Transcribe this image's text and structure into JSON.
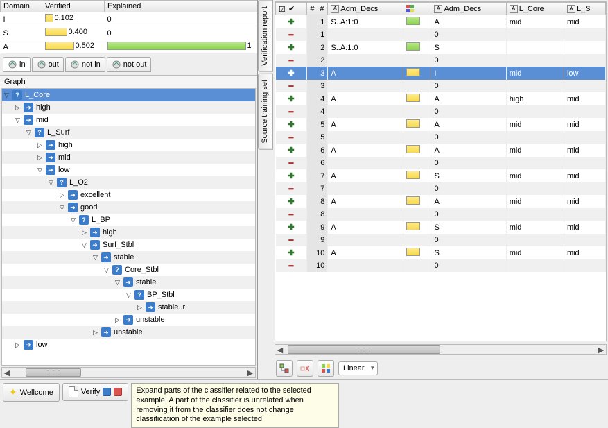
{
  "domainTable": {
    "headers": [
      "Domain",
      "Verified",
      "Explained"
    ],
    "rows": [
      {
        "domain": "I",
        "verified": "0.102",
        "verifiedBar": 12,
        "verifiedColor": "yellow",
        "explained": "0",
        "explainedBar": 0
      },
      {
        "domain": "S",
        "verified": "0.400",
        "verifiedBar": 32,
        "verifiedColor": "yellow",
        "explained": "0",
        "explainedBar": 0
      },
      {
        "domain": "A",
        "verified": "0.502",
        "verifiedBar": 42,
        "verifiedColor": "yellow",
        "explained": "1",
        "explainedBar": 200
      }
    ]
  },
  "filterTabs": [
    {
      "label": "in",
      "active": true
    },
    {
      "label": "out",
      "active": false
    },
    {
      "label": "not in",
      "active": false
    },
    {
      "label": "not out",
      "active": false
    }
  ],
  "graphLabel": "Graph",
  "tree": [
    {
      "depth": 0,
      "toggle": "▽",
      "icon": "q",
      "label": "L_Core",
      "selected": true
    },
    {
      "depth": 1,
      "toggle": "▷",
      "icon": "a",
      "label": "high"
    },
    {
      "depth": 1,
      "toggle": "▽",
      "icon": "a",
      "label": "mid"
    },
    {
      "depth": 2,
      "toggle": "▽",
      "icon": "q",
      "label": "L_Surf"
    },
    {
      "depth": 3,
      "toggle": "▷",
      "icon": "a",
      "label": "high"
    },
    {
      "depth": 3,
      "toggle": "▷",
      "icon": "a",
      "label": "mid"
    },
    {
      "depth": 3,
      "toggle": "▽",
      "icon": "a",
      "label": "low"
    },
    {
      "depth": 4,
      "toggle": "▽",
      "icon": "q",
      "label": "L_O2"
    },
    {
      "depth": 5,
      "toggle": "▷",
      "icon": "a",
      "label": "excellent"
    },
    {
      "depth": 5,
      "toggle": "▽",
      "icon": "a",
      "label": "good"
    },
    {
      "depth": 6,
      "toggle": "▽",
      "icon": "q",
      "label": "L_BP"
    },
    {
      "depth": 7,
      "toggle": "▷",
      "icon": "a",
      "label": "high"
    },
    {
      "depth": 7,
      "toggle": "▽",
      "icon": "a",
      "label": "Surf_Stbl"
    },
    {
      "depth": 8,
      "toggle": "▽",
      "icon": "a",
      "label": "stable"
    },
    {
      "depth": 9,
      "toggle": "▽",
      "icon": "q",
      "label": "Core_Stbl"
    },
    {
      "depth": 10,
      "toggle": "▽",
      "icon": "a",
      "label": "stable"
    },
    {
      "depth": 11,
      "toggle": "▽",
      "icon": "q",
      "label": "BP_Stbl"
    },
    {
      "depth": 12,
      "toggle": "▷",
      "icon": "a",
      "label": "stable..r"
    },
    {
      "depth": 10,
      "toggle": "▷",
      "icon": "a",
      "label": "unstable"
    },
    {
      "depth": 8,
      "toggle": "▷",
      "icon": "a",
      "label": "unstable"
    },
    {
      "depth": 1,
      "toggle": "▷",
      "icon": "a",
      "label": "low"
    }
  ],
  "vtabs": [
    "Verification report",
    "Source training set"
  ],
  "dataTable": {
    "headers": [
      "✔",
      "#",
      "Adm_Decs",
      "",
      "Adm_Decs",
      "L_Core",
      "L_S"
    ],
    "headerIcons": [
      "check",
      "hash",
      "A",
      "color",
      "A",
      "A",
      "A"
    ],
    "rows": [
      {
        "t": "+",
        "n": "1",
        "d1": "S..A:1:0",
        "sw": "green",
        "d2": "A",
        "c1": "mid",
        "c2": "mid"
      },
      {
        "t": "-",
        "n": "1",
        "d1": "",
        "sw": "",
        "d2": "0",
        "c1": "",
        "c2": ""
      },
      {
        "t": "+",
        "n": "2",
        "d1": "S..A:1:0",
        "sw": "green",
        "d2": "S",
        "c1": "",
        "c2": ""
      },
      {
        "t": "-",
        "n": "2",
        "d1": "",
        "sw": "",
        "d2": "0",
        "c1": "",
        "c2": ""
      },
      {
        "t": "+",
        "n": "3",
        "d1": "A",
        "sw": "yellow",
        "d2": "I",
        "c1": "mid",
        "c2": "low",
        "selected": true
      },
      {
        "t": "-",
        "n": "3",
        "d1": "",
        "sw": "",
        "d2": "0",
        "c1": "",
        "c2": ""
      },
      {
        "t": "+",
        "n": "4",
        "d1": "A",
        "sw": "yellow",
        "d2": "A",
        "c1": "high",
        "c2": "mid"
      },
      {
        "t": "-",
        "n": "4",
        "d1": "",
        "sw": "",
        "d2": "0",
        "c1": "",
        "c2": ""
      },
      {
        "t": "+",
        "n": "5",
        "d1": "A",
        "sw": "yellow",
        "d2": "A",
        "c1": "mid",
        "c2": "mid"
      },
      {
        "t": "-",
        "n": "5",
        "d1": "",
        "sw": "",
        "d2": "0",
        "c1": "",
        "c2": ""
      },
      {
        "t": "+",
        "n": "6",
        "d1": "A",
        "sw": "yellow",
        "d2": "A",
        "c1": "mid",
        "c2": "mid"
      },
      {
        "t": "-",
        "n": "6",
        "d1": "",
        "sw": "",
        "d2": "0",
        "c1": "",
        "c2": ""
      },
      {
        "t": "+",
        "n": "7",
        "d1": "A",
        "sw": "yellow",
        "d2": "S",
        "c1": "mid",
        "c2": "mid"
      },
      {
        "t": "-",
        "n": "7",
        "d1": "",
        "sw": "",
        "d2": "0",
        "c1": "",
        "c2": ""
      },
      {
        "t": "+",
        "n": "8",
        "d1": "A",
        "sw": "yellow",
        "d2": "A",
        "c1": "mid",
        "c2": "mid"
      },
      {
        "t": "-",
        "n": "8",
        "d1": "",
        "sw": "",
        "d2": "0",
        "c1": "",
        "c2": ""
      },
      {
        "t": "+",
        "n": "9",
        "d1": "A",
        "sw": "yellow",
        "d2": "S",
        "c1": "mid",
        "c2": "mid"
      },
      {
        "t": "-",
        "n": "9",
        "d1": "",
        "sw": "",
        "d2": "0",
        "c1": "",
        "c2": ""
      },
      {
        "t": "+",
        "n": "10",
        "d1": "A",
        "sw": "yellow",
        "d2": "S",
        "c1": "mid",
        "c2": "mid"
      },
      {
        "t": "-",
        "n": "10",
        "d1": "",
        "sw": "",
        "d2": "0",
        "c1": "",
        "c2": ""
      }
    ]
  },
  "rightToolbar": {
    "combo": "Linear"
  },
  "footer": {
    "wellcome": "Wellcome",
    "verify": "Verify",
    "tooltip": "Expand parts of the classifier related to the selected example. A part of the classifier is unrelated when removing it from the classifier does not change classification of the example selected"
  }
}
